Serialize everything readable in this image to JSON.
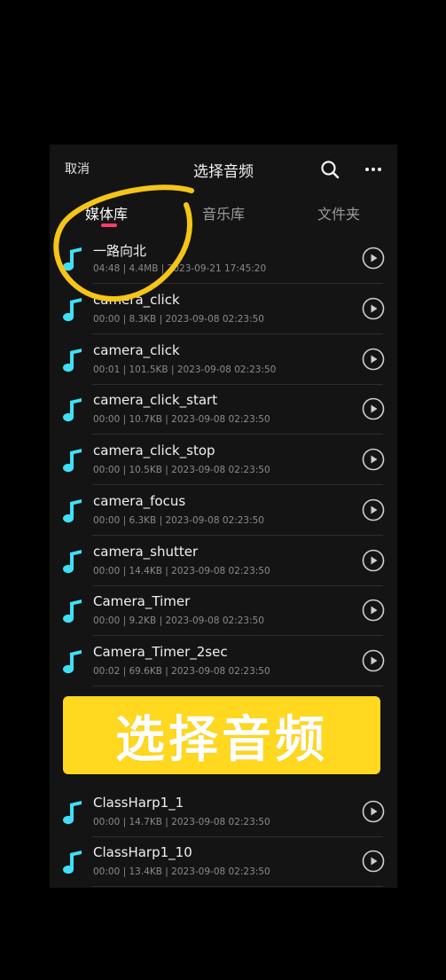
{
  "header": {
    "cancel_label": "取消",
    "title": "选择音频",
    "search_icon": "search-icon",
    "more_icon": "more-icon"
  },
  "tabs": [
    {
      "label": "媒体库",
      "active": true
    },
    {
      "label": "音乐库",
      "active": false
    },
    {
      "label": "文件夹",
      "active": false
    }
  ],
  "colors": {
    "accent_tab": "#ff3b6b",
    "note_icon": "#3fe0f5",
    "banner_bg": "#ffd81f",
    "annotation": "#f5c518"
  },
  "files": [
    {
      "name": "一路向北",
      "meta": "04:48 | 4.4MB | 2023-09-21 17:45:20"
    },
    {
      "name": "camera_click",
      "meta": "00:00 | 8.3KB | 2023-09-08 02:23:50"
    },
    {
      "name": "camera_click",
      "meta": "00:01 | 101.5KB | 2023-09-08 02:23:50"
    },
    {
      "name": "camera_click_start",
      "meta": "00:00 | 10.7KB | 2023-09-08 02:23:50"
    },
    {
      "name": "camera_click_stop",
      "meta": "00:00 | 10.5KB | 2023-09-08 02:23:50"
    },
    {
      "name": "camera_focus",
      "meta": "00:00 | 6.3KB | 2023-09-08 02:23:50"
    },
    {
      "name": "camera_shutter",
      "meta": "00:00 | 14.4KB | 2023-09-08 02:23:50"
    },
    {
      "name": "Camera_Timer",
      "meta": "00:00 | 9.2KB | 2023-09-08 02:23:50"
    },
    {
      "name": "Camera_Timer_2sec",
      "meta": "00:02 | 69.6KB | 2023-09-08 02:23:50"
    },
    {
      "name": "ClassHarp1_1",
      "meta": "00:00 | 14.7KB | 2023-09-08 02:23:50"
    },
    {
      "name": "ClassHarp1_10",
      "meta": "00:00 | 13.4KB | 2023-09-08 02:23:50"
    }
  ],
  "overlay_banner": {
    "text": "选择音频"
  }
}
